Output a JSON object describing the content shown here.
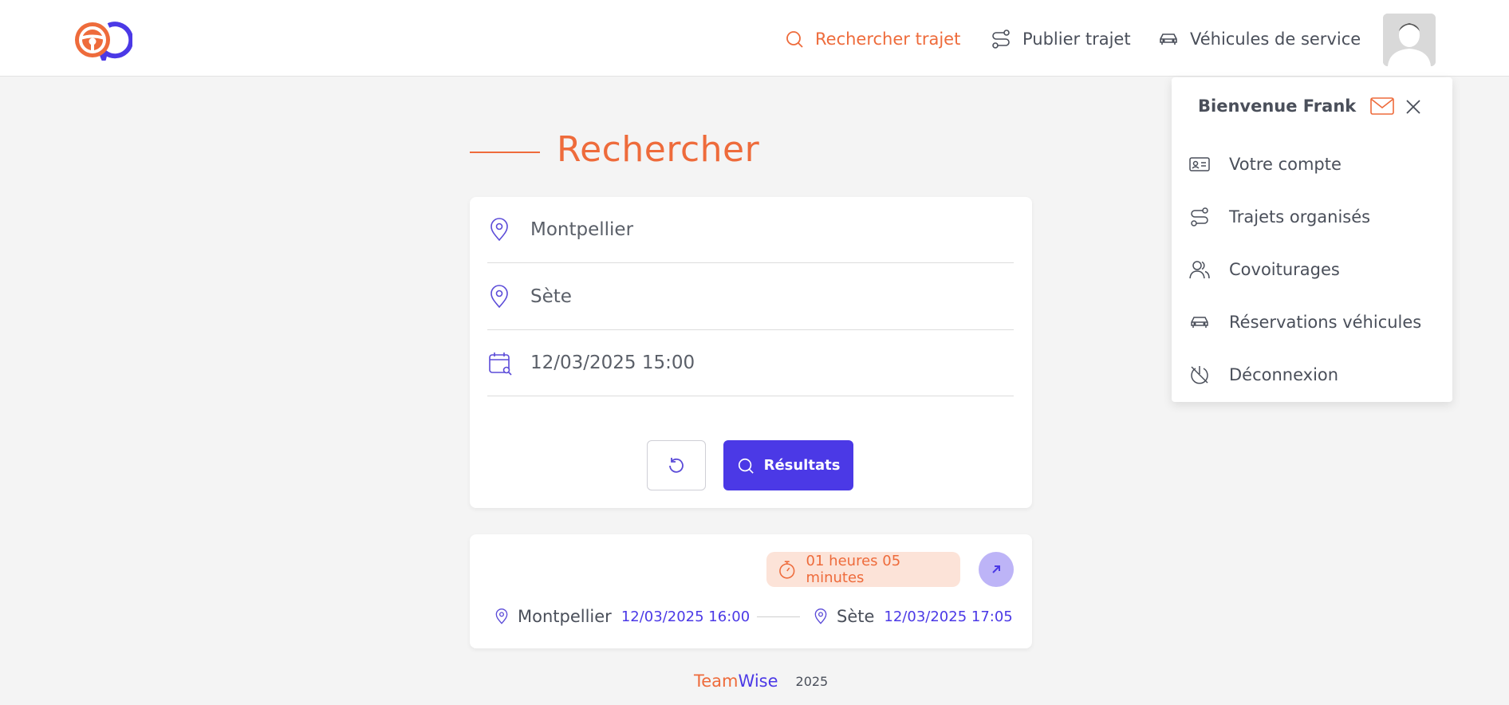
{
  "header": {
    "nav": [
      {
        "label": "Rechercher trajet",
        "icon": "search-icon",
        "active": true
      },
      {
        "label": "Publier trajet",
        "icon": "route-icon",
        "active": false
      },
      {
        "label": "Véhicules de service",
        "icon": "car-icon",
        "active": false
      }
    ],
    "avatar_icon": "user-avatar"
  },
  "search": {
    "title": "Rechercher",
    "departure": "Montpellier",
    "arrival": "Sète",
    "datetime": "12/03/2025 15:00",
    "results_label": "Résultats"
  },
  "result": {
    "duration": "01 heures 05 minutes",
    "from_city": "Montpellier",
    "from_time": "12/03/2025 16:00",
    "to_city": "Sète",
    "to_time": "12/03/2025 17:05"
  },
  "footer": {
    "brand_part1": "Team",
    "brand_part2": "Wise",
    "year": "2025"
  },
  "dropdown": {
    "welcome": "Bienvenue Frank",
    "items": [
      {
        "label": "Votre compte",
        "icon": "id-card-icon"
      },
      {
        "label": "Trajets organisés",
        "icon": "route-icon"
      },
      {
        "label": "Covoiturages",
        "icon": "users-icon"
      },
      {
        "label": "Réservations véhicules",
        "icon": "car-icon"
      },
      {
        "label": "Déconnexion",
        "icon": "logout-icon"
      }
    ]
  },
  "colors": {
    "accent_orange": "#ee6b3b",
    "accent_purple": "#4b39e6",
    "background": "#f4f4f4"
  }
}
